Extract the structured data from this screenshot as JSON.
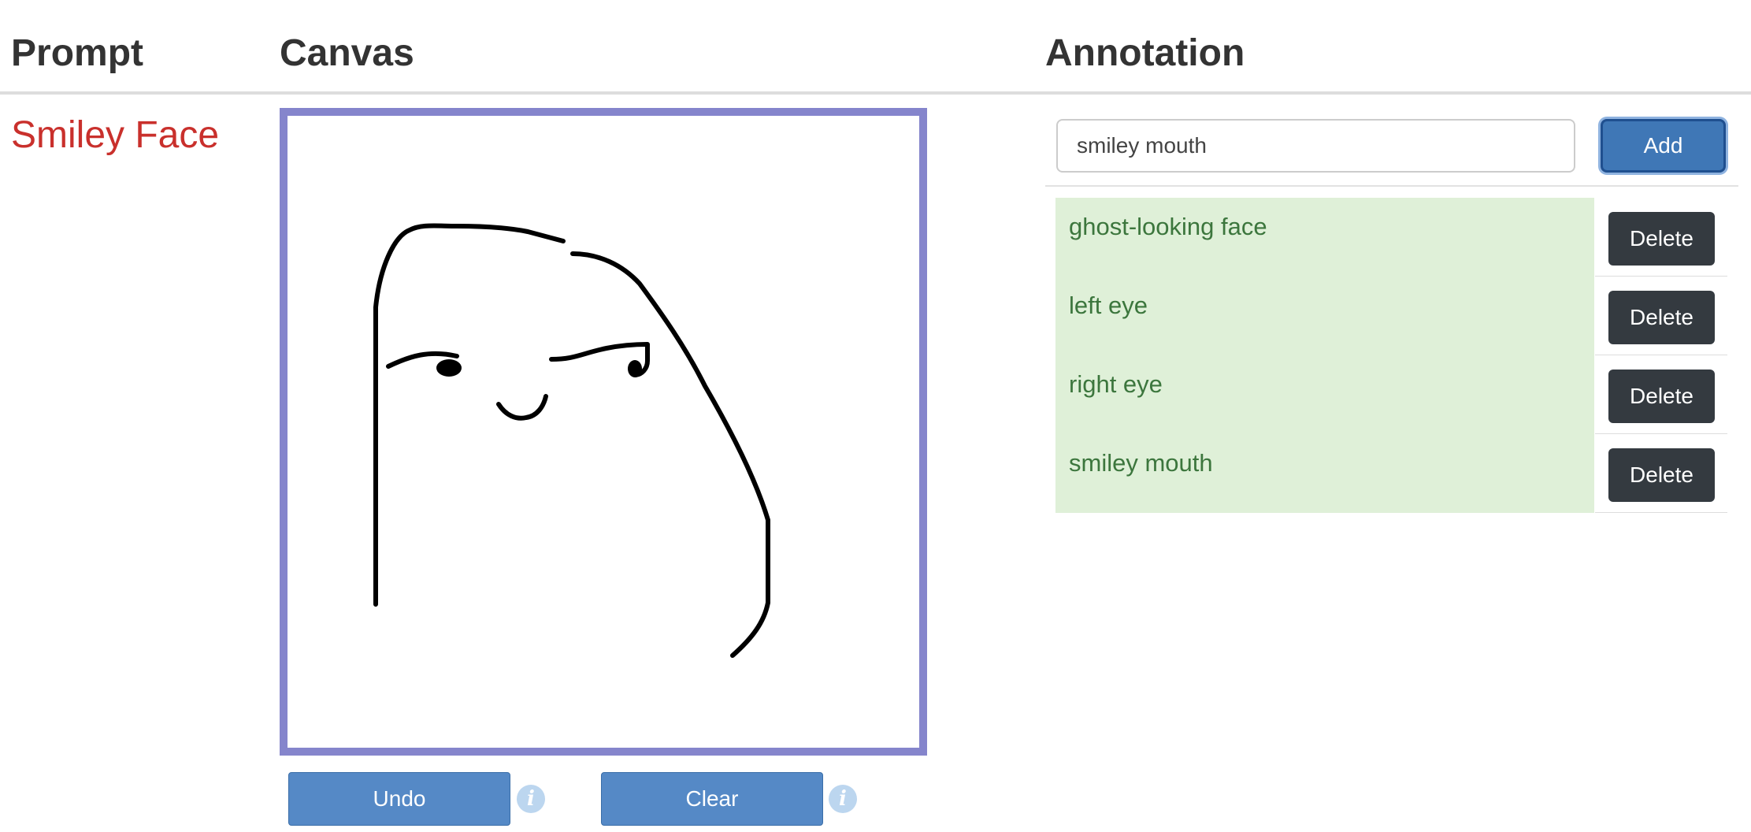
{
  "headers": {
    "prompt": "Prompt",
    "canvas": "Canvas",
    "annotation": "Annotation"
  },
  "prompt": {
    "text": "Smiley Face"
  },
  "canvas": {
    "undo_label": "Undo",
    "clear_label": "Clear",
    "info_glyph": "i"
  },
  "annotation": {
    "input_value": "smiley mouth",
    "add_label": "Add",
    "delete_label": "Delete",
    "items": [
      {
        "label": "ghost-looking face"
      },
      {
        "label": "left eye"
      },
      {
        "label": "right eye"
      },
      {
        "label": "smiley mouth"
      }
    ]
  },
  "colors": {
    "prompt_text": "#c9302c",
    "canvas_border": "#8585cc",
    "primary_button": "#5589c6",
    "add_button": "#3f77b6",
    "delete_button": "#343a40",
    "annotation_row_bg": "#dff0d8",
    "annotation_text": "#3c763d",
    "info_icon": "#bcd6ef"
  }
}
